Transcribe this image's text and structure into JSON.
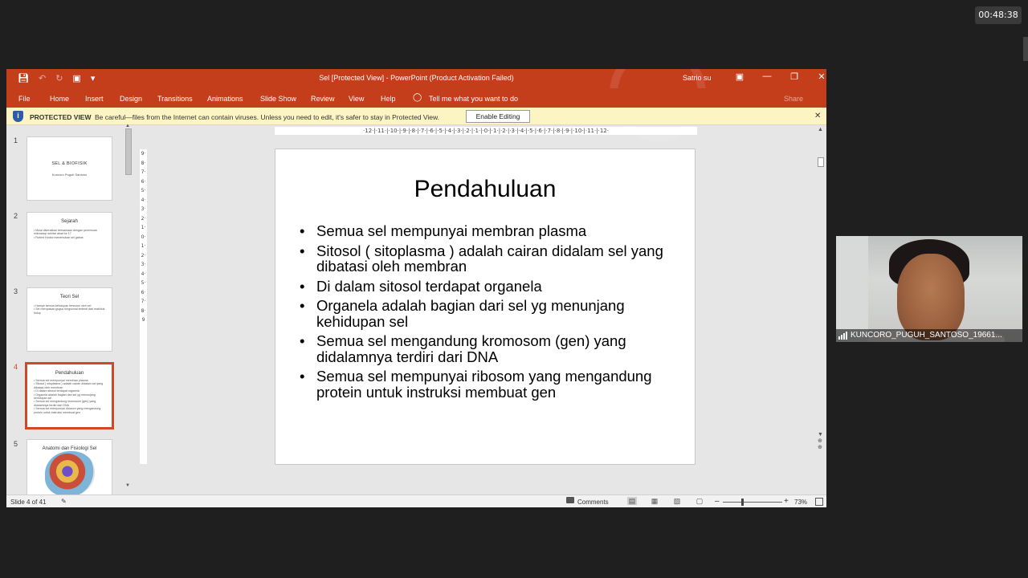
{
  "meeting": {
    "timer": "00:48:38",
    "video_label": "KUNCORO_PUGUH_SANTOSO_19661..."
  },
  "window": {
    "title": "Sel [Protected View]  -  PowerPoint (Product Activation Failed)",
    "user": "Satrio su"
  },
  "ribbon": {
    "tabs": [
      "File",
      "Home",
      "Insert",
      "Design",
      "Transitions",
      "Animations",
      "Slide Show",
      "Review",
      "View",
      "Help"
    ],
    "tell_me": "Tell me what you want to do",
    "share": "Share"
  },
  "protected_bar": {
    "title": "PROTECTED VIEW",
    "message": "Be careful—files from the Internet can contain viruses. Unless you need to edit, it's safer to stay in Protected View.",
    "button": "Enable Editing"
  },
  "thumbnails": [
    {
      "num": "1",
      "title": "SEL & BIOFISIK",
      "subtitle": "Kuncoro Puguh Santoso"
    },
    {
      "num": "2",
      "title": "Sejarah",
      "bullets": [
        "Mulai dikenalkan bersamaan dengan penemuan mikroskop sekitar abad ke 17",
        "Robert Hooke menemukan sel gabus"
      ]
    },
    {
      "num": "3",
      "title": "Teori Sel",
      "bullets": [
        "Hampir semua kehidupan tersusun oleh sel",
        "Sel merupakan gugus fungsional terkecil dari makhluk hidup"
      ]
    },
    {
      "num": "4",
      "title": "Pendahuluan",
      "bullets": [
        "Semua sel mempunyai membran plasma",
        "Sitosol ( sitoplasma ) adalah cairan didalam sel yang dibatasi oleh membran",
        "Di dalam sitosol terdapat organela",
        "Organela adalah bagian dari sel yg menunjang kehidupan sel",
        "Semua sel mengandung kromosom (gen) yang didalamnya terdiri dari DNA",
        "Semua sel mempunyai ribosom yang mengandung protein untuk instruksi membuat gen"
      ]
    },
    {
      "num": "5",
      "title": "Anatomi dan Fisiologi Sel"
    }
  ],
  "rulers": {
    "horizontal": "·12·|·11·|·10·|·9·|·8·|·7·|·6·|·5·|·4·|·3·|·2·|·1·|·0·|·1·|·2·|·3·|·4·|·5·|·6·|·7·|·8·|·9·|·10·|·11·|·12·",
    "vertical": "9·8·7·6·5·4·3·2·1·0·1·2·3·4·5·6·7·8·9"
  },
  "slide": {
    "title": "Pendahuluan",
    "bullets": [
      "Semua sel mempunyai membran plasma",
      "Sitosol ( sitoplasma ) adalah cairan didalam sel yang dibatasi oleh membran",
      "Di dalam sitosol terdapat organela",
      "Organela adalah bagian dari sel yg menunjang kehidupan sel",
      "Semua sel mengandung kromosom (gen) yang didalamnya terdiri dari DNA",
      "Semua sel mempunyai ribosom yang mengandung protein untuk instruksi membuat gen"
    ]
  },
  "statusbar": {
    "slide_count": "Slide 4 of 41",
    "comments": "Comments",
    "zoom": "73%"
  },
  "colors": {
    "accent": "#c43e1c",
    "selected_thumb": "#d24726",
    "protected_bar": "#fcf5c3"
  }
}
